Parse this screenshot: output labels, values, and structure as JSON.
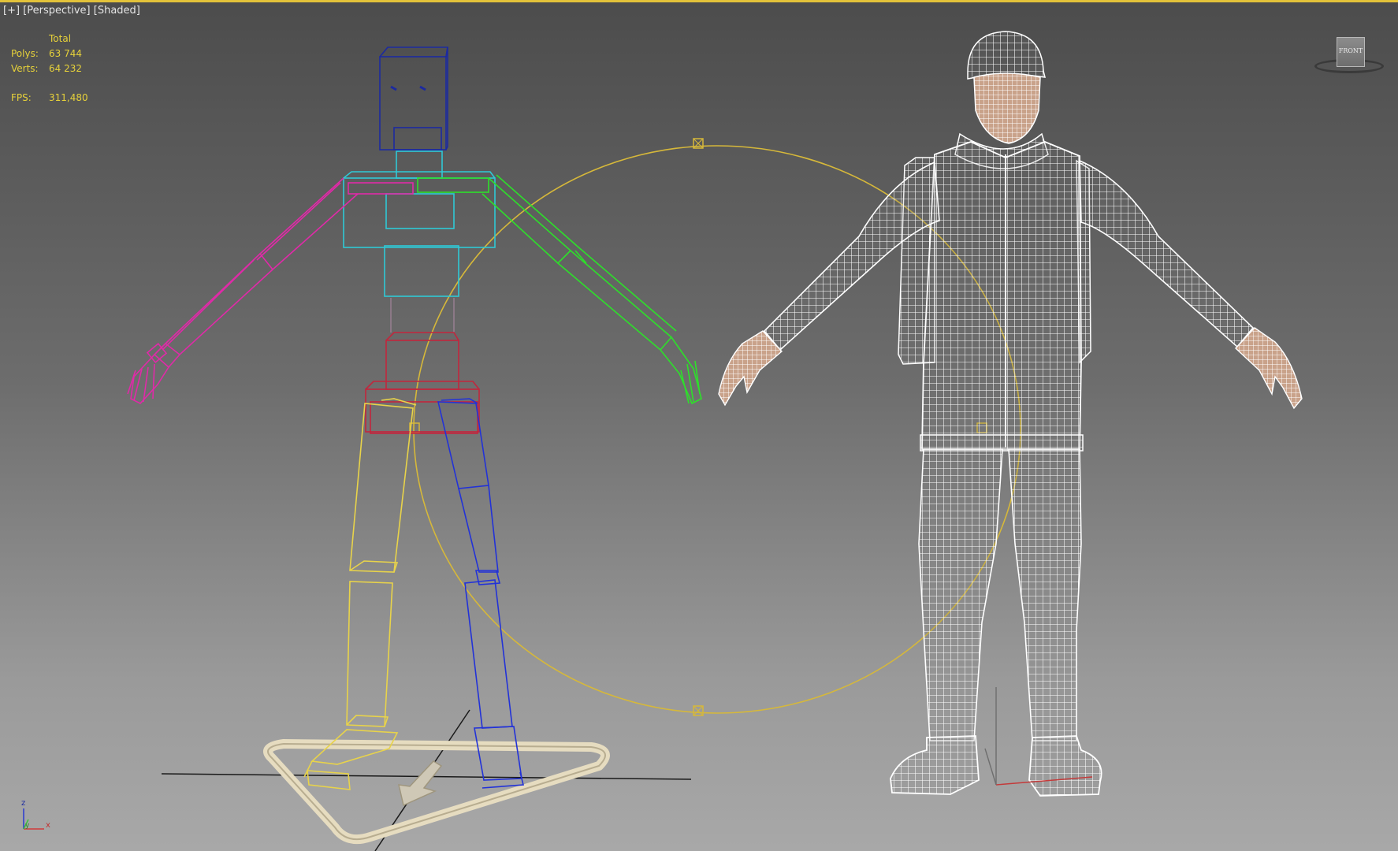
{
  "viewport": {
    "menu_plus": "[+]",
    "view_name": "[Perspective]",
    "shading": "[Shaded]"
  },
  "stats": {
    "header": "Total",
    "polys_label": "Polys:",
    "polys_value": "63 744",
    "verts_label": "Verts:",
    "verts_value": "64 232",
    "fps_label": "FPS:",
    "fps_value": "311,480"
  },
  "viewcube": {
    "face_label": "FRONT"
  },
  "axis_gizmo": {
    "z": "z",
    "y": "y",
    "x": "x"
  },
  "colors": {
    "active_border": "#e3c23a",
    "stats_text": "#e6d13a",
    "biped_head": "#1c2aa0",
    "biped_spine": "#2fc9d6",
    "biped_left_arm": "#e02aa8",
    "biped_right_arm": "#2de02a",
    "biped_pelvis": "#c2263d",
    "biped_left_leg": "#e8d34a",
    "biped_right_leg": "#2232d8",
    "ik_circle": "#d6b83a",
    "mesh_wire": "#ffffff"
  }
}
